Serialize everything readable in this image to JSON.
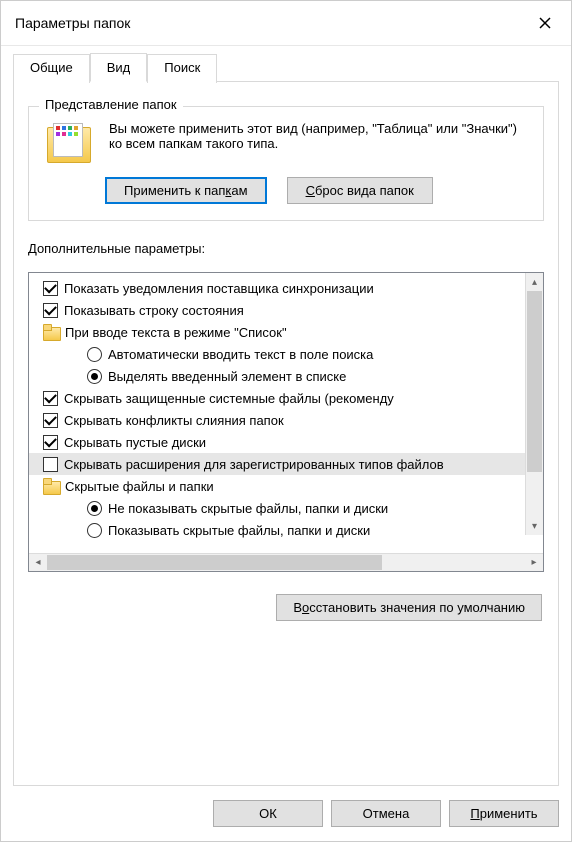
{
  "window": {
    "title": "Параметры папок"
  },
  "tabs": {
    "general": "Общие",
    "view": "Вид",
    "search": "Поиск"
  },
  "folderViews": {
    "legend": "Представление папок",
    "description": "Вы можете применить этот вид (например, \"Таблица\" или \"Значки\") ко всем папкам такого типа.",
    "apply": "Применить к папкам",
    "reset": "Сброс вида папок"
  },
  "advanced": {
    "label": "Дополнительные параметры:",
    "items": [
      {
        "kind": "check",
        "checked": true,
        "indent": 0,
        "text": "Показать уведомления поставщика синхронизации"
      },
      {
        "kind": "check",
        "checked": true,
        "indent": 0,
        "text": "Показывать строку состояния"
      },
      {
        "kind": "folder",
        "indent": 0,
        "text": "При вводе текста в режиме \"Список\""
      },
      {
        "kind": "radio",
        "selected": false,
        "indent": 1,
        "text": "Автоматически вводить текст в поле поиска"
      },
      {
        "kind": "radio",
        "selected": true,
        "indent": 1,
        "text": "Выделять введенный элемент в списке"
      },
      {
        "kind": "check",
        "checked": true,
        "indent": 0,
        "text": "Скрывать защищенные системные файлы (рекоменду"
      },
      {
        "kind": "check",
        "checked": true,
        "indent": 0,
        "text": "Скрывать конфликты слияния папок"
      },
      {
        "kind": "check",
        "checked": true,
        "indent": 0,
        "text": "Скрывать пустые диски"
      },
      {
        "kind": "check",
        "checked": false,
        "indent": 0,
        "highlight": true,
        "text": "Скрывать расширения для зарегистрированных типов файлов"
      },
      {
        "kind": "folder",
        "indent": 0,
        "text": "Скрытые файлы и папки"
      },
      {
        "kind": "radio",
        "selected": true,
        "indent": 1,
        "text": "Не показывать скрытые файлы, папки и диски"
      },
      {
        "kind": "radio",
        "selected": false,
        "indent": 1,
        "text": "Показывать скрытые файлы, папки и диски"
      }
    ],
    "restoreDefaults": "Восстановить значения по умолчанию"
  },
  "buttons": {
    "ok": "ОК",
    "cancel": "Отмена",
    "apply": "Применить"
  }
}
